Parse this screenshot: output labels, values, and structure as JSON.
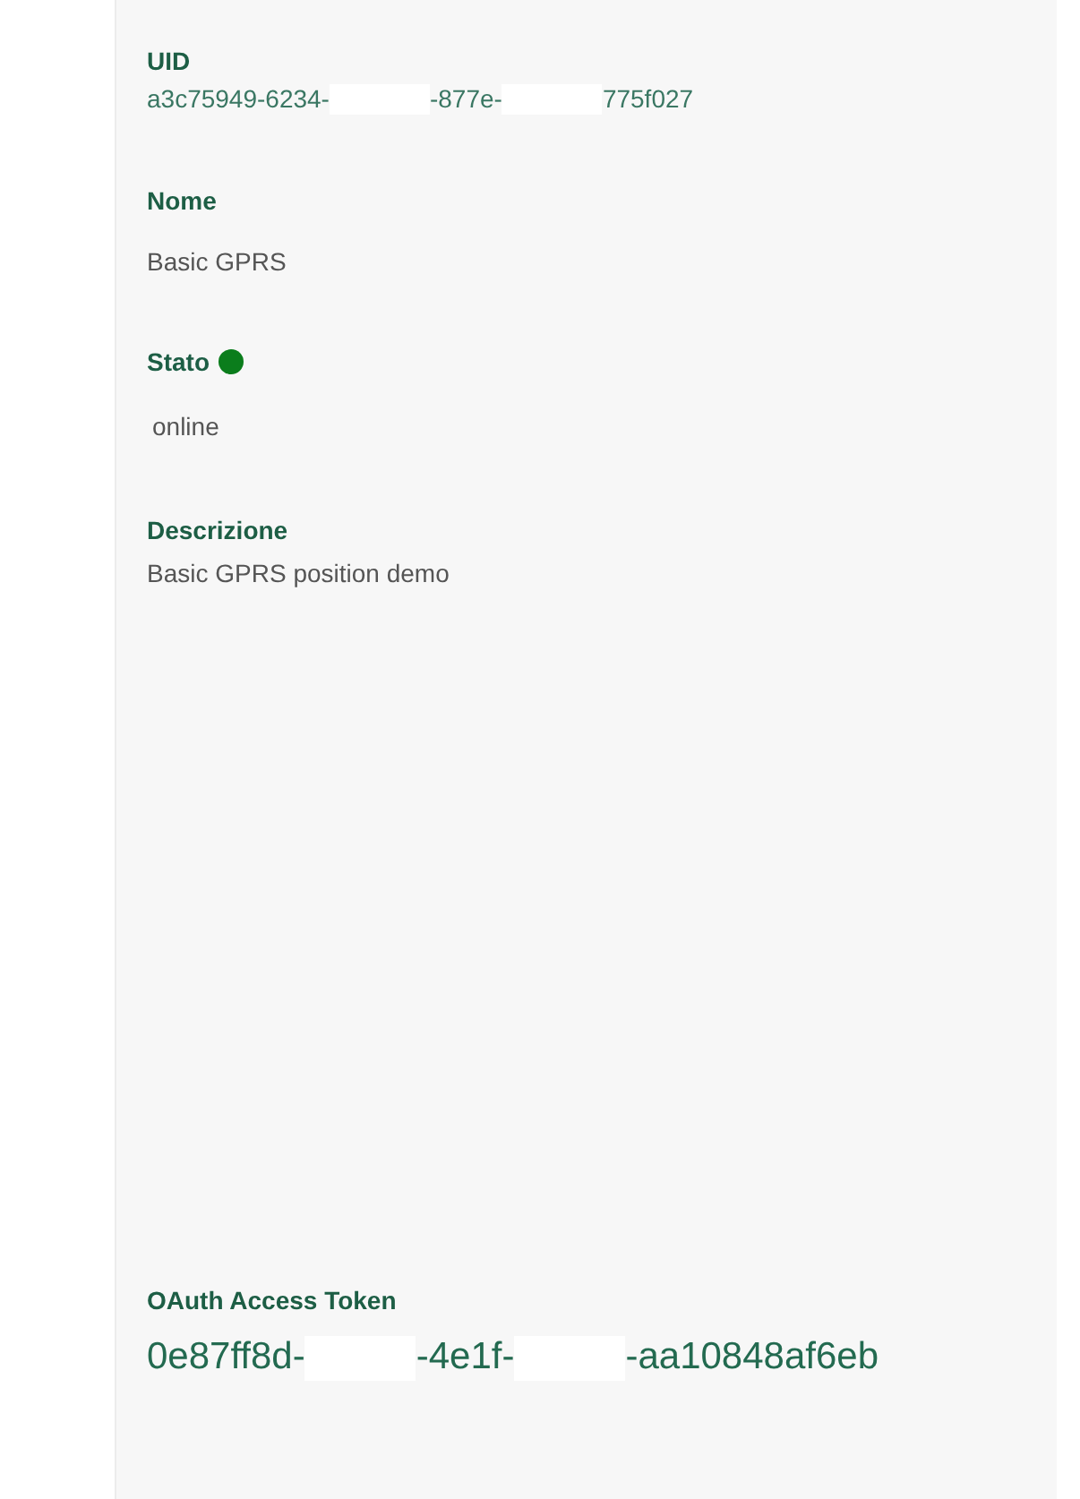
{
  "fields": [
    {
      "kind": "parts",
      "label": "UID",
      "parts": [
        "a3c75949-6234-",
        "-877e-",
        "775f027"
      ]
    },
    {
      "kind": "text",
      "label": "Nome",
      "value": "Basic GPRS"
    },
    {
      "kind": "status",
      "label": "Stato",
      "color": "#0b7d1c",
      "value": "online"
    },
    {
      "kind": "text",
      "label": "Descrizione",
      "value": "Basic GPRS position demo"
    },
    {
      "kind": "token",
      "label": "OAuth Access Token",
      "parts": [
        "0e87ff8d-",
        "-4e1f-",
        "-aa10848af6eb"
      ]
    }
  ]
}
